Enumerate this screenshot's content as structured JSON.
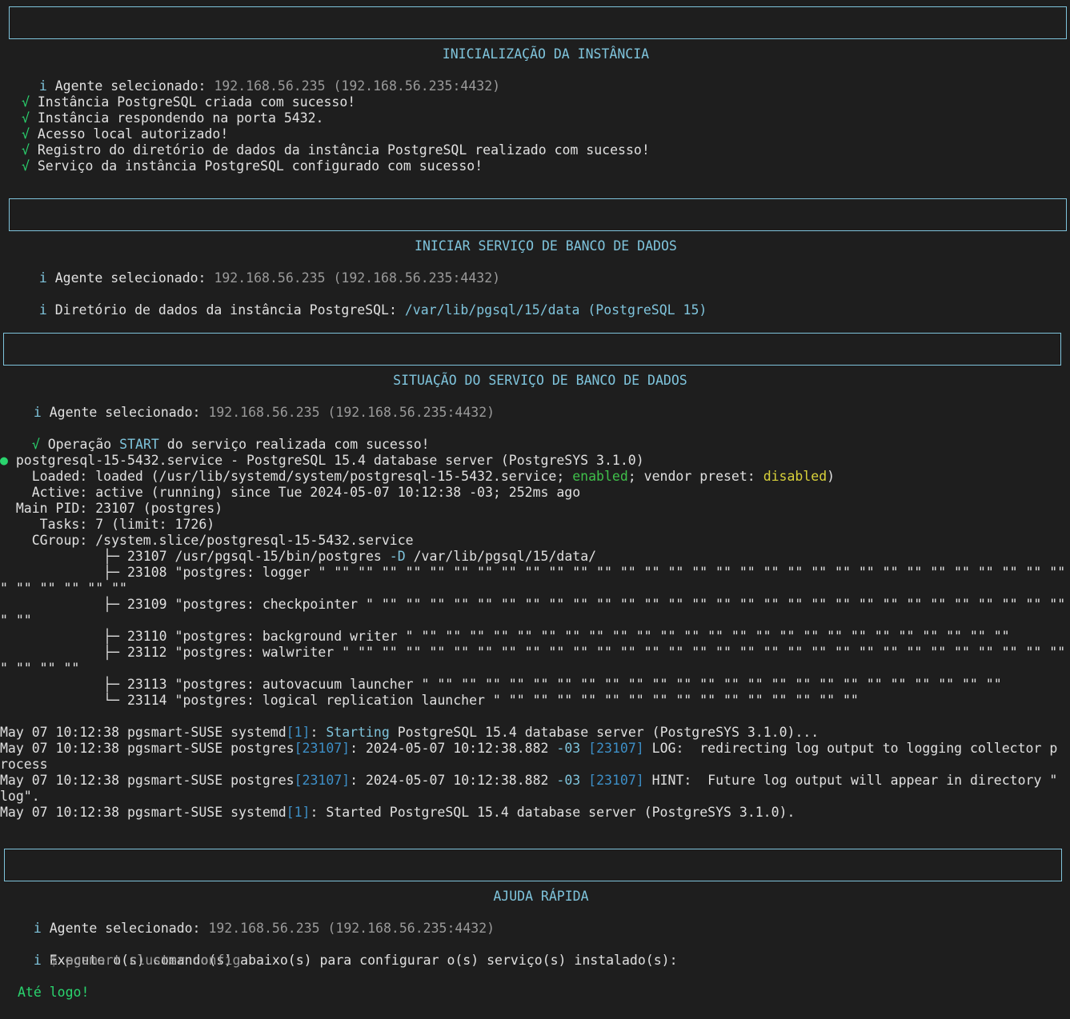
{
  "sections": {
    "init_title": "INICIALIZAÇÃO DA INSTÂNCIA",
    "start_title": "INICIAR SERVIÇO DE BANCO DE DADOS",
    "status_title": "SITUAÇÃO DO SERVIÇO DE BANCO DE DADOS",
    "help_title": "AJUDA RÁPIDA"
  },
  "agent": {
    "label": "Agente selecionado:",
    "value": "192.168.56.235 (192.168.56.235:4432)"
  },
  "symbols": {
    "info": "i",
    "ok": "√",
    "bullet": "●"
  },
  "init": {
    "msgs": [
      "Instância PostgreSQL criada com sucesso!",
      "Instância respondendo na porta 5432.",
      "Acesso local autorizado!",
      "Registro do diretório de dados da instância PostgreSQL realizado com sucesso!",
      "Serviço da instância PostgreSQL configurado com sucesso!"
    ]
  },
  "start": {
    "dir_label": "Diretório de dados da instância PostgreSQL:",
    "dir_value": "/var/lib/pgsql/15/data (PostgreSQL 15)"
  },
  "status": {
    "op_prefix": "Operação",
    "op_keyword": "START",
    "op_suffix": "do serviço realizada com sucesso!",
    "service_line": "postgresql-15-5432.service - PostgreSQL 15.4 database server (PostgreSYS 3.1.0)",
    "loaded_a": "    Loaded: loaded (/usr/lib/systemd/system/postgresql-15-5432.service; ",
    "loaded_enabled": "enabled",
    "loaded_b": "; vendor preset: ",
    "loaded_disabled": "disabled",
    "loaded_c": ")",
    "active": "    Active: active (running) since Tue 2024-05-07 10:12:38 -03; 252ms ago",
    "main_pid": "  Main PID: 23107 (postgres)",
    "tasks": "     Tasks: 7 (limit: 1726)",
    "cgroup": "    CGroup: /system.slice/postgresql-15-5432.service",
    "tree_1_branch": "             ├─ ",
    "tree_1_a": "23107 /usr/pgsql-15/bin/postgres ",
    "tree_1_flag": "-D",
    "tree_1_b": " /var/lib/pgsql/15/data/",
    "tree_2": "             ├─ 23108 \"postgres: logger \" \"\" \"\" \"\" \"\" \"\" \"\" \"\" \"\" \"\" \"\" \"\" \"\" \"\" \"\" \"\" \"\" \"\" \"\" \"\" \"\" \"\" \"\" \"\" \"\" \"\" \"\" \"\" \"\" \"\" \"\" \"\" \"",
    "tree_2_wrap": "\" \"\" \"\" \"\" \"\" \"\"",
    "tree_3": "             ├─ 23109 \"postgres: checkpointer \" \"\" \"\" \"\" \"\" \"\" \"\" \"\" \"\" \"\" \"\" \"\" \"\" \"\" \"\" \"\" \"\" \"\" \"\" \"\" \"\" \"\" \"\" \"\" \"\" \"\" \"\" \"\" \"\" \"\" \"",
    "tree_3_wrap": "\" \"\"",
    "tree_4": "             ├─ 23110 \"postgres: background writer \" \"\" \"\" \"\" \"\" \"\" \"\" \"\" \"\" \"\" \"\" \"\" \"\" \"\" \"\" \"\" \"\" \"\" \"\" \"\" \"\" \"\" \"\" \"\" \"\" \"\"",
    "tree_5": "             ├─ 23112 \"postgres: walwriter \" \"\" \"\" \"\" \"\" \"\" \"\" \"\" \"\" \"\" \"\" \"\" \"\" \"\" \"\" \"\" \"\" \"\" \"\" \"\" \"\" \"\" \"\" \"\" \"\" \"\" \"\" \"\" \"\" \"\" \"\" \"",
    "tree_5_wrap": "\" \"\" \"\" \"\"",
    "tree_6": "             ├─ 23113 \"postgres: autovacuum launcher \" \"\" \"\" \"\" \"\" \"\" \"\" \"\" \"\" \"\" \"\" \"\" \"\" \"\" \"\" \"\" \"\" \"\" \"\" \"\" \"\" \"\" \"\" \"\" \"\"",
    "tree_7": "             └─ 23114 \"postgres: logical replication launcher \" \"\" \"\" \"\" \"\" \"\" \"\" \"\" \"\" \"\" \"\" \"\" \"\" \"\" \"\" \"\"",
    "log_prefix": "May 07 10:12:38 pgsmart-SUSE ",
    "log1_proc": "systemd",
    "log1_pid": "[1]",
    "log1_colon": ": ",
    "log1_kw": "Starting",
    "log1_rest": " PostgreSQL 15.4 database server (PostgreSYS 3.1.0)...",
    "log2_proc": "postgres",
    "log2_pid": "[23107]",
    "log2_a": ": 2024-05-07 10:12:38.882 ",
    "log2_tz": "-03",
    "log2_sp": " ",
    "log2_pid2": "[23107]",
    "log2_rest": " LOG:  redirecting log output to logging collector p",
    "log2_wrap": "rocess",
    "log3_rest": " HINT:  Future log output will appear in directory \"",
    "log3_wrap": "log\".",
    "log4_rest": ": Started PostgreSQL 15.4 database server (PostgreSYS 3.1.0)."
  },
  "help": {
    "exec_msg": "Execute o(s) comando(s) abaixo(s) para configurar o(s) serviço(s) instalado(s):",
    "command": "$ pgsmart cluster config",
    "bye": "Até logo!"
  }
}
